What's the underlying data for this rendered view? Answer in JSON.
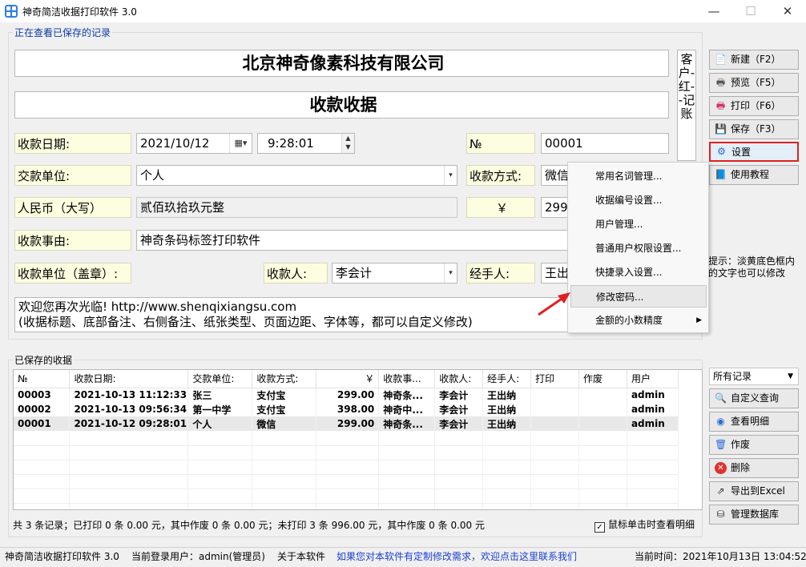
{
  "window": {
    "title": "神奇简洁收据打印软件 3.0",
    "minimize": "—",
    "maximize": "☐",
    "close": "✕"
  },
  "form": {
    "group_label": "正在查看已保存的记录",
    "company": "北京神奇像素科技有限公司",
    "doc_title": "收款收据",
    "side_label": "客户-红--记账",
    "date_label": "收款日期:",
    "date_value": "2021/10/12",
    "time_value": "9:28:01",
    "no_label": "№",
    "no_value": "00001",
    "payer_label": "交款单位:",
    "payer_value": "个人",
    "method_label": "收款方式:",
    "method_value": "微信",
    "rmb_label": "人民币（大写）",
    "rmb_value": "贰佰玖拾玖元整",
    "yen_label": "￥",
    "yen_value": "299.",
    "reason_label": "收款事由:",
    "reason_value": "神奇条码标签打印软件",
    "unit_label": "收款单位（盖章）:",
    "receiver_label": "收款人:",
    "receiver_value": "李会计",
    "handler_label": "经手人:",
    "handler_value": "王出",
    "remark_line1": "欢迎您再次光临! http://www.shenqixiangsu.com",
    "remark_line2": "(收据标题、底部备注、右侧备注、纸张类型、页面边距、字体等，都可以自定义修改)"
  },
  "buttons": {
    "new": "新建（F2）",
    "preview": "预览（F5）",
    "print": "打印（F6）",
    "save": "保存（F3）",
    "settings": "设置",
    "tutorial": "使用教程",
    "custom_query": "自定义查询",
    "view_detail": "查看明细",
    "void": "作废",
    "delete": "删除",
    "export": "导出到Excel",
    "db": "管理数据库"
  },
  "hint": "提示：淡黄底色框内的文字也可以修改",
  "menu": {
    "items": [
      "常用名词管理...",
      "收据编号设置...",
      "用户管理...",
      "普通用户权限设置...",
      "快捷录入设置...",
      "修改密码...",
      "金额的小数精度"
    ]
  },
  "records": {
    "group_label": "已保存的收据",
    "filter": "所有记录",
    "columns": [
      "№",
      "收款日期:",
      "交款单位:",
      "收款方式:",
      "￥",
      "收款事...",
      "收款人:",
      "经手人:",
      "打印",
      "作废",
      "用户"
    ],
    "rows": [
      [
        "00003",
        "2021-10-13 11:12:33",
        "张三",
        "支付宝",
        "299.00",
        "神奇条...",
        "李会计",
        "王出纳",
        "",
        "",
        "admin"
      ],
      [
        "00002",
        "2021-10-13 09:56:34",
        "第一中学",
        "支付宝",
        "398.00",
        "神奇中...",
        "李会计",
        "王出纳",
        "",
        "",
        "admin"
      ],
      [
        "00001",
        "2021-10-12 09:28:01",
        "个人",
        "微信",
        "299.00",
        "神奇条...",
        "李会计",
        "王出纳",
        "",
        "",
        "admin"
      ]
    ],
    "summary": "共 3 条记录；已打印 0 条 0.00 元，其中作废 0 条 0.00 元；未打印 3 条 996.00 元，其中作废 0 条 0.00 元",
    "checkbox_label": "鼠标单击时查看明细",
    "checkbox_mark": "✓"
  },
  "status": {
    "app": "神奇简洁收据打印软件 3.0",
    "user": "当前登录用户：admin(管理员)",
    "about": "关于本软件",
    "link": "如果您对本软件有定制修改需求，欢迎点击这里联系我们",
    "time": "当前时间：2021年10月13日 13:04:52"
  },
  "colors": {
    "accent": "#0a39a8",
    "label_bg": "#fdfde0",
    "arrow": "#e02020",
    "settings_border": "#e02020"
  }
}
